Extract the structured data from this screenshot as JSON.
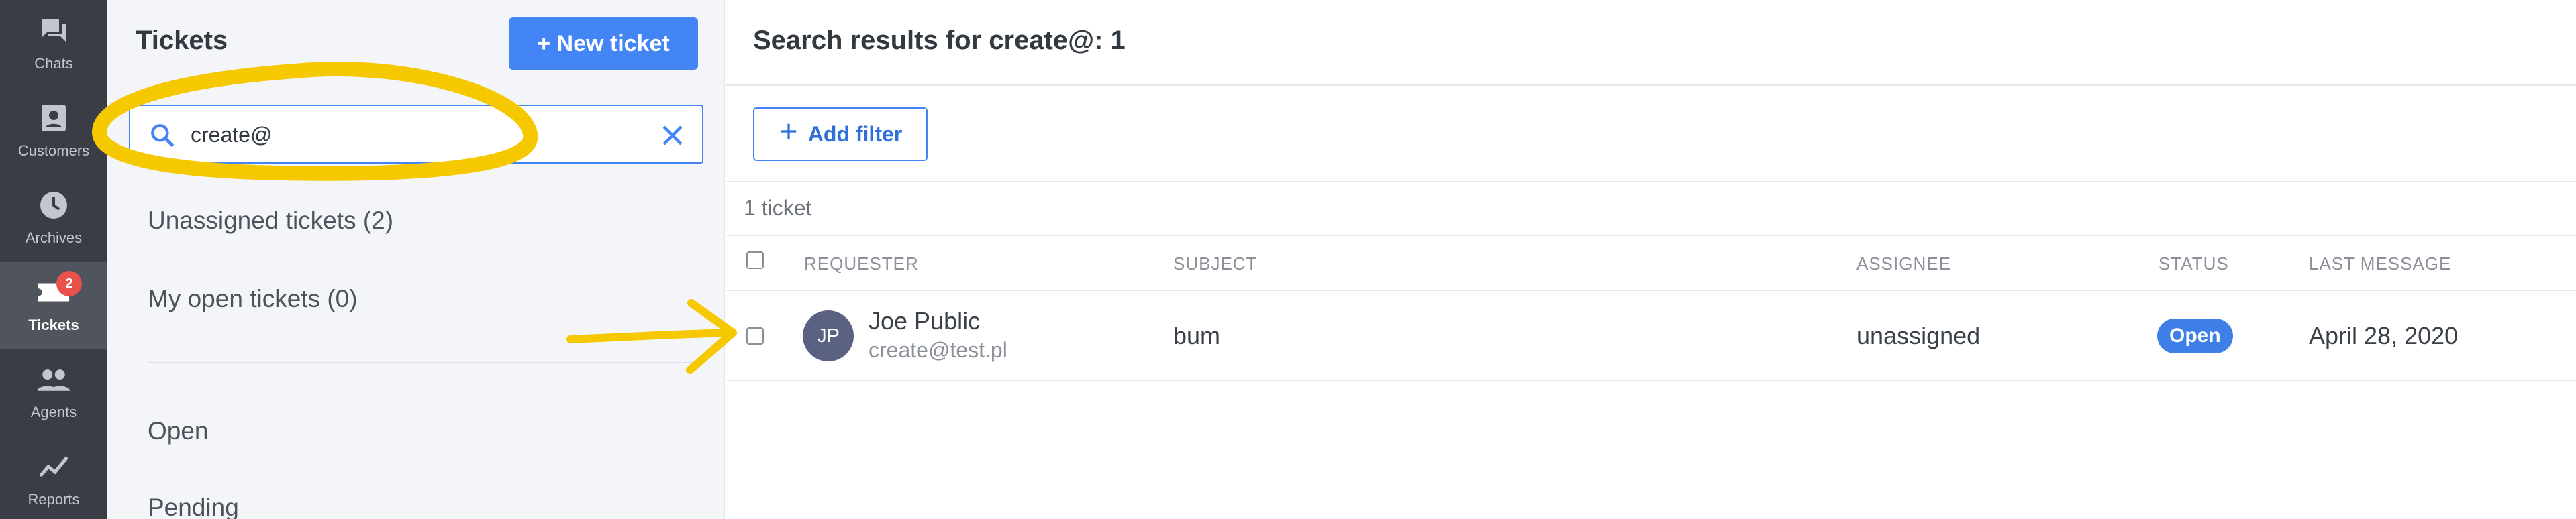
{
  "rail": {
    "items": [
      {
        "label": "Chats",
        "icon": "chats-icon"
      },
      {
        "label": "Customers",
        "icon": "customers-icon"
      },
      {
        "label": "Archives",
        "icon": "archives-icon"
      },
      {
        "label": "Tickets",
        "icon": "tickets-icon",
        "badge": "2",
        "active": true
      },
      {
        "label": "Agents",
        "icon": "agents-icon"
      },
      {
        "label": "Reports",
        "icon": "reports-icon"
      }
    ]
  },
  "panel": {
    "title": "Tickets",
    "new_ticket_label": "+ New ticket",
    "search": {
      "value": "create@"
    },
    "filters": [
      "Unassigned tickets (2)",
      "My open tickets (0)",
      "Open",
      "Pending"
    ]
  },
  "main": {
    "results_prefix": "Search results for ",
    "results_query": "create@",
    "results_suffix": ": 1",
    "add_filter_label": "Add filter",
    "ticket_count": "1 ticket",
    "columns": {
      "requester": "REQUESTER",
      "subject": "SUBJECT",
      "assignee": "ASSIGNEE",
      "status": "STATUS",
      "last_message": "LAST MESSAGE"
    },
    "rows": [
      {
        "initials": "JP",
        "name": "Joe Public",
        "email": "create@test.pl",
        "subject": "bum",
        "assignee": "unassigned",
        "status": "Open",
        "last_message": "April 28, 2020"
      }
    ]
  },
  "colors": {
    "accent": "#4385f5",
    "rail_bg": "#3a3d45",
    "badge": "#e8524a",
    "annotation": "#f5c800"
  }
}
